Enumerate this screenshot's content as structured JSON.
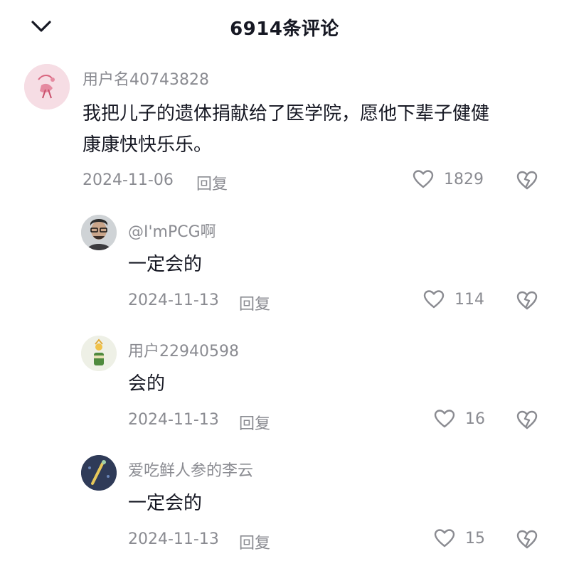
{
  "header": {
    "title": "6914条评论"
  },
  "comments": [
    {
      "username": "用户名40743828",
      "text": "我把儿子的遗体捐献给了医学院，愿他下辈子健健康康快快乐乐。",
      "text_line1": "我把儿子的遗体捐献给了医学院，愿他下辈子健健",
      "text_line2": "康康快快乐乐。",
      "date": "2024-11-06",
      "reply_label": "回复",
      "likes": "1829"
    }
  ],
  "replies": [
    {
      "username": "@I'mPCG啊",
      "text": "一定会的",
      "date": "2024-11-13",
      "reply_label": "回复",
      "likes": "114"
    },
    {
      "username": "用户22940598",
      "text": "会的",
      "date": "2024-11-13",
      "reply_label": "回复",
      "likes": "16"
    },
    {
      "username": "爱吃鲜人参的李云",
      "text": "一定会的",
      "date": "2024-11-13",
      "reply_label": "回复",
      "likes": "15"
    }
  ],
  "icons": {
    "back": "chevron-down-icon",
    "like": "heart-outline-icon",
    "dislike": "broken-heart-icon"
  },
  "colors": {
    "text_primary": "#161823",
    "text_secondary": "#8a8b91"
  }
}
